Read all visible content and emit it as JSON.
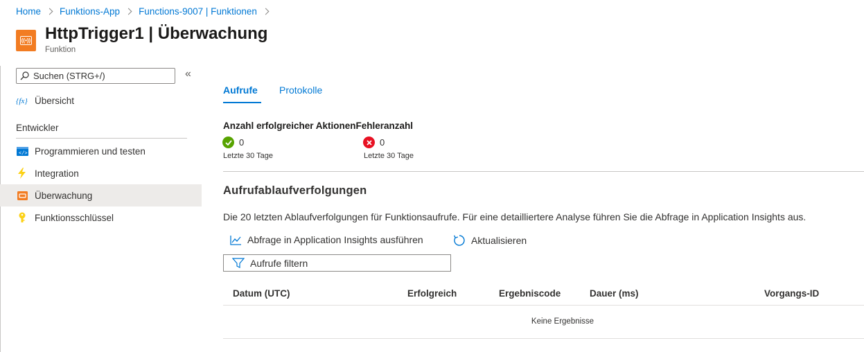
{
  "breadcrumb": {
    "items": [
      "Home",
      "Funktions-App",
      "Functions-9007 | Funktionen"
    ]
  },
  "header": {
    "title_bold": "HttpTrigger1",
    "title_rest": " | Überwachung",
    "subtitle": "Funktion",
    "icon": "function-monitor-icon"
  },
  "sidebar": {
    "search_placeholder": "Suchen (STRG+/)",
    "collapse_label": "«",
    "overview_label": "Übersicht",
    "section_label": "Entwickler",
    "items": [
      {
        "label": "Programmieren und testen",
        "icon": "code-icon"
      },
      {
        "label": "Integration",
        "icon": "lightning-icon"
      },
      {
        "label": "Überwachung",
        "icon": "monitor-icon",
        "active": true
      },
      {
        "label": "Funktionsschlüssel",
        "icon": "key-icon"
      }
    ]
  },
  "tabs": {
    "active": "Aufrufe",
    "inactive": "Protokolle"
  },
  "stats": {
    "header": "Anzahl erfolgreicher AktionenFehleranzahl",
    "success_value": "0",
    "success_sub": "Letzte 30 Tage",
    "error_value": "0",
    "error_sub": "Letzte 30 Tage"
  },
  "traces": {
    "title": "Aufrufablaufverfolgungen",
    "description": "Die 20 letzten Ablaufverfolgungen für Funktionsaufrufe. Für eine detailliertere Analyse führen Sie die Abfrage in Application Insights aus.",
    "run_query_label": "Abfrage in Application Insights ausführen",
    "refresh_label": "Aktualisieren",
    "filter_placeholder": "Aufrufe filtern",
    "columns": [
      "Datum (UTC)",
      "Erfolgreich",
      "Ergebniscode",
      "Dauer (ms)",
      "Vorgangs-ID"
    ],
    "empty_text": "Keine Ergebnisse"
  },
  "colors": {
    "accent": "#0078d4",
    "success": "#57a300",
    "error": "#e81123",
    "function_icon": "#f27c22"
  }
}
